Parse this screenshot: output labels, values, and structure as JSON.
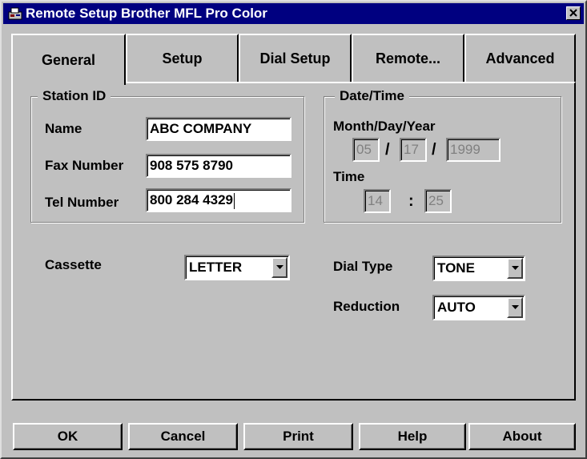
{
  "window": {
    "title": "Remote Setup Brother MFL Pro Color"
  },
  "tabs": [
    "General",
    "Setup",
    "Dial Setup",
    "Remote...",
    "Advanced"
  ],
  "station_id": {
    "title": "Station ID",
    "name_label": "Name",
    "name_value": "ABC COMPANY",
    "fax_label": "Fax Number",
    "fax_value": "908 575 8790",
    "tel_label": "Tel Number",
    "tel_value": "800 284 4329"
  },
  "date_time": {
    "title": "Date/Time",
    "date_label": "Month/Day/Year",
    "month": "05",
    "day": "17",
    "year": "1999",
    "date_sep": "/",
    "time_label": "Time",
    "hour": "14",
    "minute": "25",
    "time_sep": ":"
  },
  "options": {
    "cassette_label": "Cassette",
    "cassette_value": "LETTER",
    "dial_type_label": "Dial Type",
    "dial_type_value": "TONE",
    "reduction_label": "Reduction",
    "reduction_value": "AUTO"
  },
  "buttons": {
    "ok": "OK",
    "cancel": "Cancel",
    "print": "Print",
    "help": "Help",
    "about": "About"
  },
  "icons": {
    "app": "fax-machine-icon",
    "close": "close-icon",
    "dropdown": "chevron-down-icon"
  },
  "colors": {
    "titlebar": "#000080",
    "face": "#c0c0c0"
  }
}
